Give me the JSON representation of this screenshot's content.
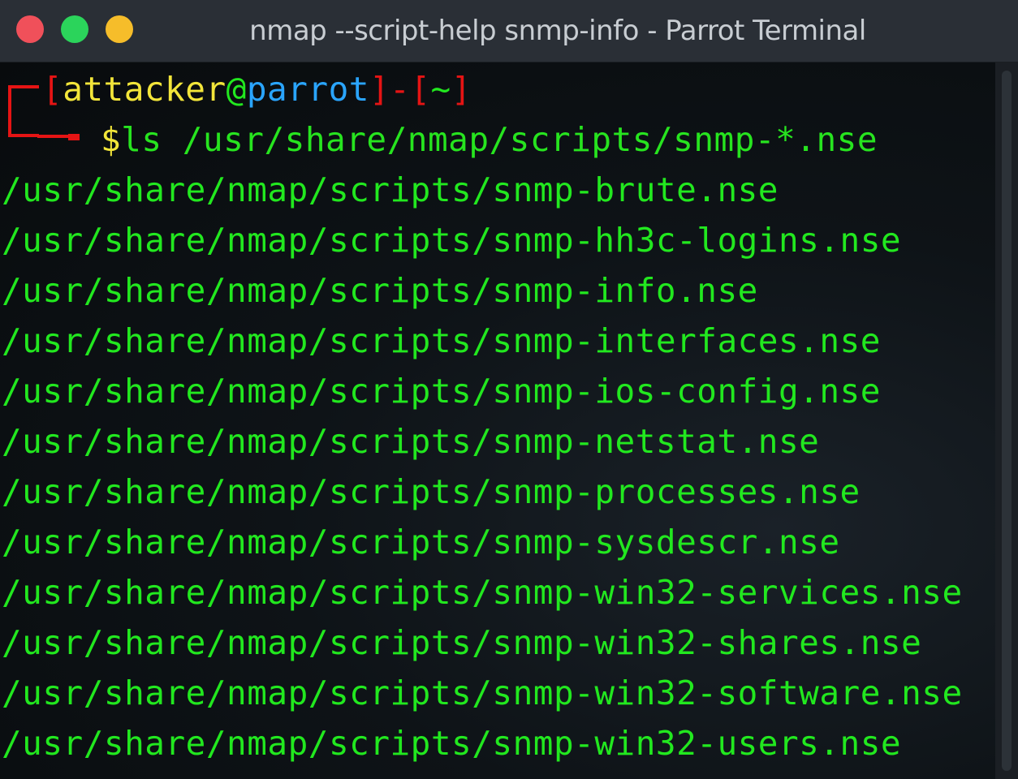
{
  "window": {
    "title": "nmap --script-help snmp-info - Parrot Terminal"
  },
  "prompt": {
    "open_bracket": "[",
    "user": "attacker",
    "at": "@",
    "host": "parrot",
    "close_bracket": "]",
    "dash": "-",
    "dir_open": "[",
    "dir": "~",
    "dir_close": "]",
    "symbol": "$",
    "command": "ls /usr/share/nmap/scripts/snmp-*.nse"
  },
  "output": [
    "/usr/share/nmap/scripts/snmp-brute.nse",
    "/usr/share/nmap/scripts/snmp-hh3c-logins.nse",
    "/usr/share/nmap/scripts/snmp-info.nse",
    "/usr/share/nmap/scripts/snmp-interfaces.nse",
    "/usr/share/nmap/scripts/snmp-ios-config.nse",
    "/usr/share/nmap/scripts/snmp-netstat.nse",
    "/usr/share/nmap/scripts/snmp-processes.nse",
    "/usr/share/nmap/scripts/snmp-sysdescr.nse",
    "/usr/share/nmap/scripts/snmp-win32-services.nse",
    "/usr/share/nmap/scripts/snmp-win32-shares.nse",
    "/usr/share/nmap/scripts/snmp-win32-software.nse",
    "/usr/share/nmap/scripts/snmp-win32-users.nse"
  ],
  "colors": {
    "prompt_bracket": "#e51414",
    "user": "#f2e53a",
    "host": "#2aa5ff",
    "output": "#22e81f",
    "close_button": "#f0505a",
    "maximize_button": "#2bd45b",
    "minimize_button": "#f6bd2a"
  }
}
